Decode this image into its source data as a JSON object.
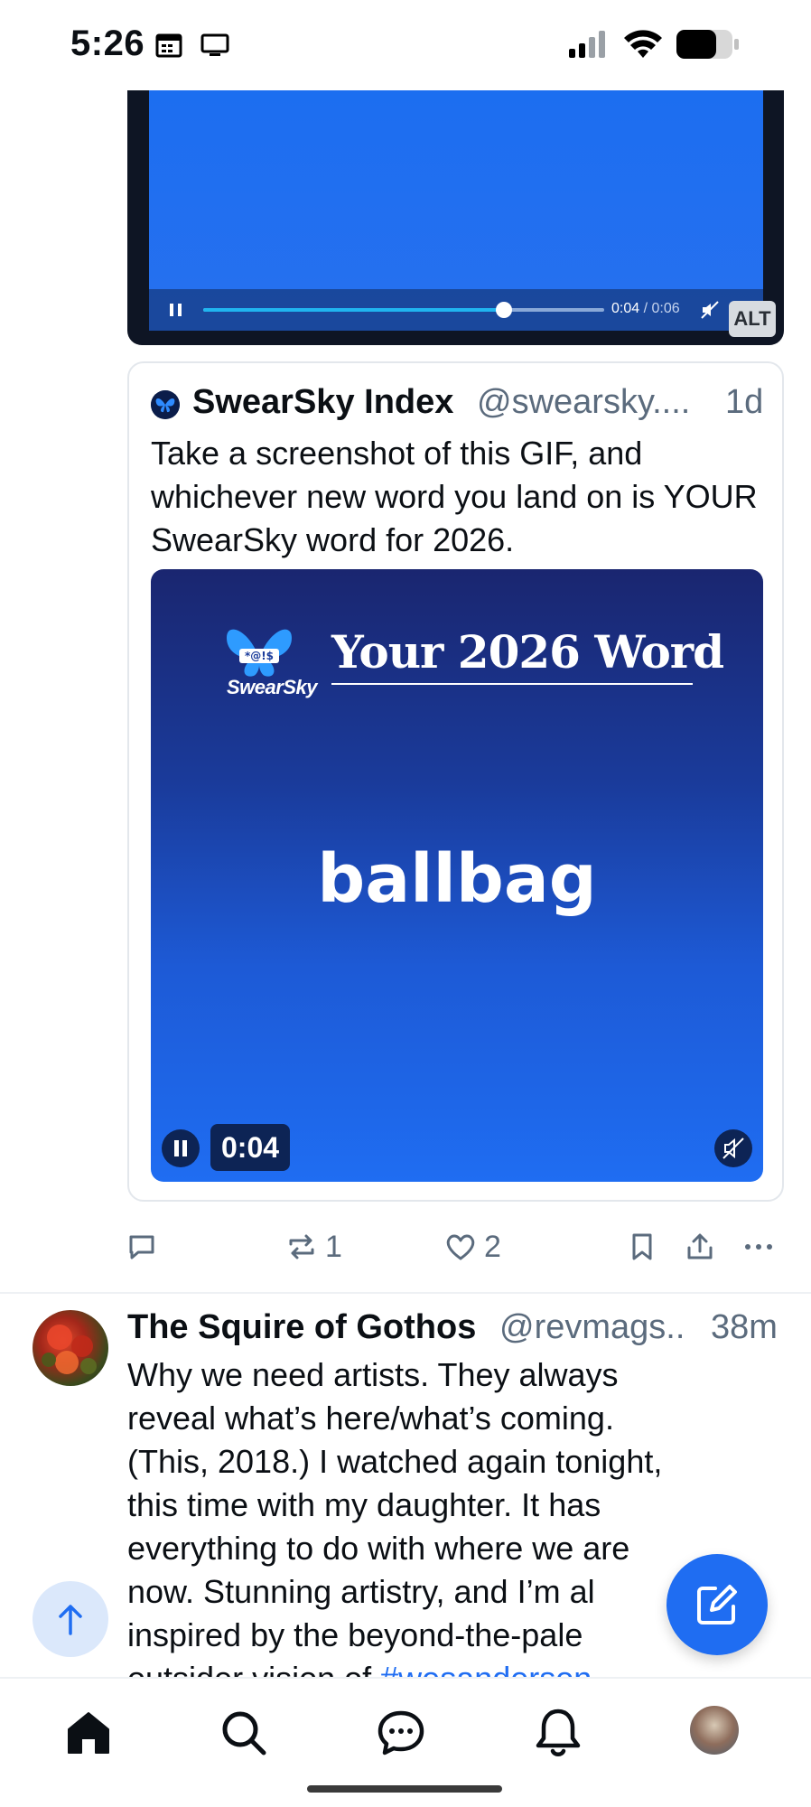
{
  "status_bar": {
    "time": "5:26",
    "icons": [
      "calendar-icon",
      "screen-icon",
      "signal-icon",
      "wifi-icon",
      "battery-icon"
    ]
  },
  "video_player": {
    "current_time": "0:04",
    "separator": " / ",
    "duration": "0:06",
    "progress": 0.75,
    "alt_label": "ALT"
  },
  "quote_post": {
    "author_name": "SwearSky Index",
    "author_handle": "@swearsky....",
    "timestamp": "1d",
    "text": "Take a screenshot of this GIF, and whichever new word you land on is YOUR SwearSky word for 2026.",
    "gif": {
      "brand": "SwearSky",
      "title": "Your 2026 Word",
      "word": "ballbag",
      "time": "0:04"
    }
  },
  "actions": {
    "reply_count": "",
    "repost_count": "1",
    "like_count": "2"
  },
  "post2": {
    "author_name": "The Squire of Gothos",
    "author_handle": "@revmags..",
    "timestamp": "38m",
    "text_lines": [
      "Why we need artists. They always",
      "reveal what’s here/what’s coming.",
      "(This, 2018.) I watched again tonight,",
      "this time with my daughter. It has",
      "everything to do with where we are",
      "now. Stunning artistry, and I’m al",
      "inspired by the  beyond-the-pale"
    ],
    "partial_line": "outsider vision of ",
    "hashtag": "#wesanderson"
  },
  "nav": {
    "items": [
      "home-icon",
      "search-icon",
      "chat-icon",
      "bell-icon",
      "profile-avatar"
    ]
  },
  "colors": {
    "accent": "#1f6df2",
    "muted": "#5b6b7d"
  }
}
